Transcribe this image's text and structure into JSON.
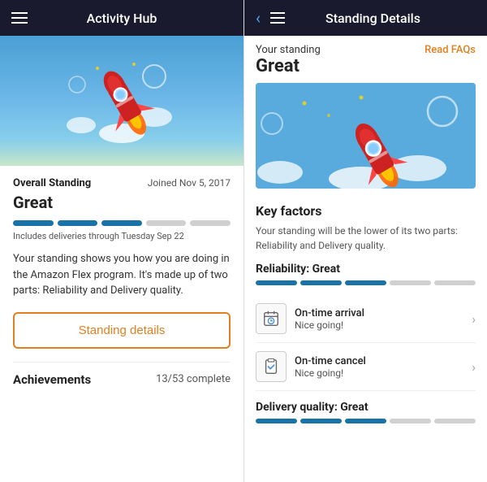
{
  "left": {
    "header": {
      "title": "Activity Hub"
    },
    "standing": {
      "label": "Overall Standing",
      "value": "Great",
      "joined": "Joined Nov 5, 2017",
      "delivery_note": "Includes deliveries through Tuesday Sep 22",
      "description": "Your standing shows you how you are doing in the Amazon Flex program. It's made up of two parts: Reliability and Delivery quality.",
      "details_button": "Standing details",
      "progress_filled": 3,
      "progress_total": 5
    },
    "achievements": {
      "label": "Achievements",
      "count": "13/53 complete"
    }
  },
  "right": {
    "header": {
      "title": "Standing Details",
      "back_label": "‹",
      "faqs_label": "Read FAQs"
    },
    "standing": {
      "your_standing_label": "Your standing",
      "value": "Great"
    },
    "key_factors": {
      "title": "Key factors",
      "description": "Your standing will be the lower of its two parts: Reliability and Delivery quality.",
      "reliability_label": "Reliability: Great",
      "progress_filled": 3,
      "progress_total": 5,
      "items": [
        {
          "title": "On-time arrival",
          "subtitle": "Nice going!"
        },
        {
          "title": "On-time cancel",
          "subtitle": "Nice going!"
        }
      ],
      "delivery_quality_label": "Delivery quality: Great",
      "dq_progress_filled": 3,
      "dq_progress_total": 5
    }
  }
}
